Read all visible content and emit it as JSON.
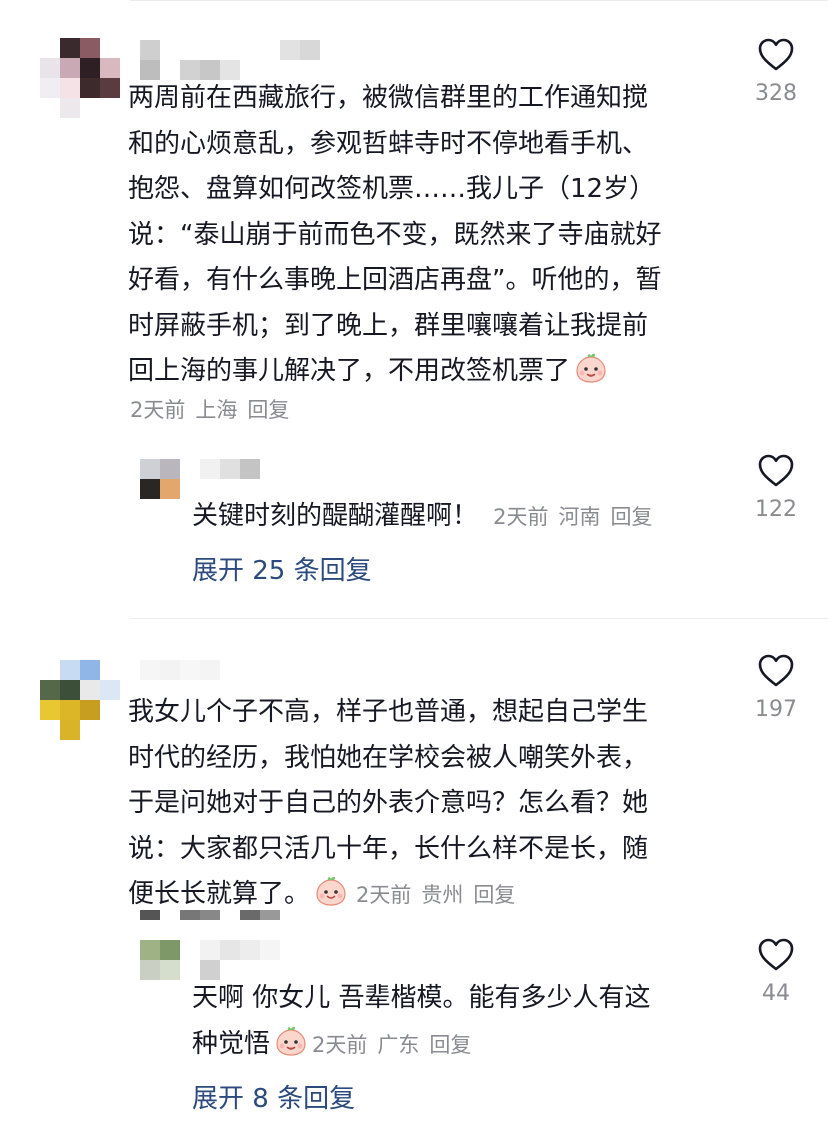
{
  "comments": [
    {
      "text": "两周前在西藏旅行，被微信群里的工作通知搅\n和的心烦意乱，参观哲蚌寺时不停地看手机、\n抱怨、盘算如何改签机票……我儿子（12岁）\n说：“泰山崩于前而色不变，既然来了寺庙就好\n好看，有什么事晚上回酒店再盘”。听他的，暂\n时屏蔽手机；到了晚上，群里嚷嚷着让我提前\n回上海的事儿解决了，不用改签机票了",
      "time": "2天前",
      "location": "上海",
      "reply_label": "回复",
      "likes": "328",
      "reply": {
        "text": "关键时刻的醍醐灌醒啊！",
        "time": "2天前",
        "location": "河南",
        "reply_label": "回复",
        "likes": "122"
      },
      "expand_label": "展开 25 条回复"
    },
    {
      "text": "我女儿个子不高，样子也普通，想起自己学生\n时代的经历，我怕她在学校会被人嘲笑外表，\n于是问她对于自己的外表介意吗？怎么看？她\n说：大家都只活几十年，长什么样不是长，随\n便长长就算了。",
      "time": "2天前",
      "location": "贵州",
      "reply_label": "回复",
      "likes": "197",
      "reply": {
        "text": "天啊 你女儿 吾辈楷模。能有多少人有这\n种觉悟",
        "time": "2天前",
        "location": "广东",
        "reply_label": "回复",
        "likes": "44"
      },
      "expand_label": "展开 8 条回复"
    }
  ],
  "icons": {
    "like": "heart-outline-icon",
    "emoji_tongue": "peach-emoji-icon",
    "emoji_smile": "peach-smile-emoji-icon"
  },
  "colors": {
    "text": "#161823",
    "meta": "#8a8b91",
    "link": "#2c4a7d"
  }
}
